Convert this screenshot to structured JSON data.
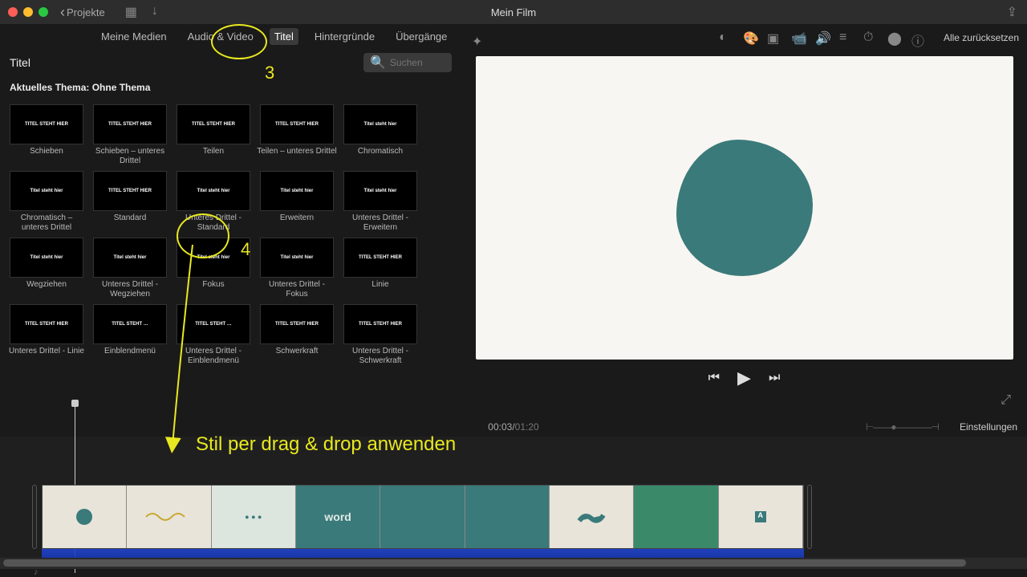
{
  "window": {
    "title": "Mein Film",
    "back": "Projekte"
  },
  "tabs": {
    "items": [
      "Meine Medien",
      "Audio & Video",
      "Titel",
      "Hintergründe",
      "Übergänge"
    ],
    "selected": 2
  },
  "toolbar": {
    "reset": "Alle zurücksetzen"
  },
  "panel": {
    "title": "Titel",
    "theme": "Aktuelles Thema: Ohne Thema",
    "search_placeholder": "Suchen"
  },
  "titles": [
    {
      "label": "Schieben",
      "thumb": "TITEL STEHT HIER"
    },
    {
      "label": "Schieben – unteres Drittel",
      "thumb": "TITEL STEHT HIER"
    },
    {
      "label": "Teilen",
      "thumb": "TITEL STEHT HIER"
    },
    {
      "label": "Teilen – unteres Drittel",
      "thumb": "TITEL STEHT HIER"
    },
    {
      "label": "Chromatisch",
      "thumb": "Titel steht hier"
    },
    {
      "label": "Chromatisch – unteres Drittel",
      "thumb": "Titel steht hier"
    },
    {
      "label": "Standard",
      "thumb": "TITEL STEHT HIER"
    },
    {
      "label": "Unteres Drittel - Standard",
      "thumb": "Titel steht hier"
    },
    {
      "label": "Erweitern",
      "thumb": "Titel steht hier"
    },
    {
      "label": "Unteres Drittel - Erweitern",
      "thumb": "Titel steht hier"
    },
    {
      "label": "Wegziehen",
      "thumb": "Titel steht hier"
    },
    {
      "label": "Unteres Drittel - Wegziehen",
      "thumb": "Titel steht hier"
    },
    {
      "label": "Fokus",
      "thumb": "Titel steht hier"
    },
    {
      "label": "Unteres Drittel - Fokus",
      "thumb": "Titel steht hier"
    },
    {
      "label": "Linie",
      "thumb": "TITEL STEHT HIER"
    },
    {
      "label": "Unteres Drittel - Linie",
      "thumb": "TITEL STEHT HIER"
    },
    {
      "label": "Einblendmenü",
      "thumb": "TITEL STEHT …"
    },
    {
      "label": "Unteres Drittel - Einblendmenü",
      "thumb": "TITEL STEHT …"
    },
    {
      "label": "Schwerkraft",
      "thumb": "TITEL STEHT HIER"
    },
    {
      "label": "Unteres Drittel - Schwerkraft",
      "thumb": "TITEL STEHT HIER"
    }
  ],
  "time": {
    "current": "00:03",
    "sep": " / ",
    "duration": "01:20",
    "settings": "Einstellungen"
  },
  "annotations": {
    "n3": "3",
    "n4": "4",
    "drag": "Stil per drag & drop anwenden"
  },
  "colors": {
    "accent": "#3a7a7a",
    "annotation": "#e8e820"
  }
}
